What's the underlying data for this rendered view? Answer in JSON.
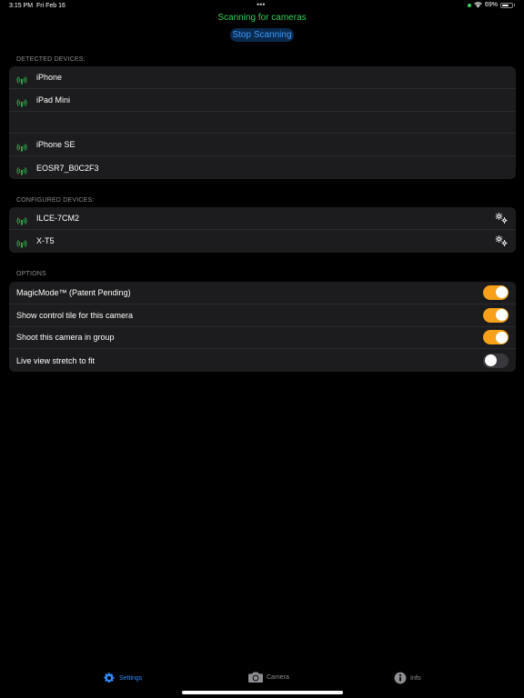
{
  "status_bar": {
    "time": "3:15 PM",
    "date": "Fri Feb 16",
    "dots": "•••",
    "battery": "69%",
    "battery_level": 0.69
  },
  "header": {
    "title": "Scanning for cameras",
    "stop_button": "Stop Scanning"
  },
  "detected": {
    "header": "DETECTED DEVICES:",
    "items": [
      {
        "label": "iPhone",
        "icon": "signal-icon"
      },
      {
        "label": "iPad Mini",
        "icon": "signal-icon"
      },
      {
        "label": "",
        "icon": ""
      },
      {
        "label": "iPhone SE",
        "icon": "signal-icon"
      },
      {
        "label": "EOSR7_B0C2F3",
        "icon": "signal-icon"
      }
    ]
  },
  "configured": {
    "header": "CONFIGURED DEVICES:",
    "items": [
      {
        "label": "ILCE-7CM2",
        "icon": "signal-icon",
        "action_icon": "gears-icon"
      },
      {
        "label": "X-T5",
        "icon": "signal-icon",
        "action_icon": "gears-icon"
      }
    ]
  },
  "options": {
    "header": "OPTIONS",
    "items": [
      {
        "label": "MagicMode™ (Patent Pending)",
        "on": true
      },
      {
        "label": "Show control tile for this camera",
        "on": true
      },
      {
        "label": "Shoot this camera in group",
        "on": true
      },
      {
        "label": "Live view stretch to fit",
        "on": false
      }
    ]
  },
  "tabs": [
    {
      "label": "Settings",
      "icon": "gear-icon",
      "active": true
    },
    {
      "label": "Camera",
      "icon": "camera-icon",
      "active": false
    },
    {
      "label": "Info",
      "icon": "info-icon",
      "active": false
    }
  ],
  "colors": {
    "accent_green": "#30d158",
    "accent_blue": "#2f8cff",
    "toggle_on": "#f7a11a",
    "group_bg": "#1c1c1e"
  }
}
